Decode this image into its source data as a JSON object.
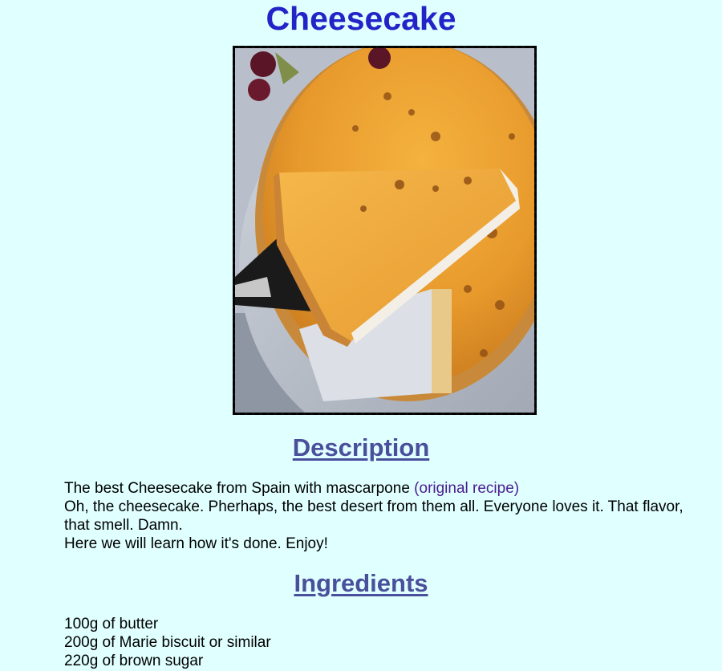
{
  "page": {
    "title": "Cheesecake",
    "image_description": "Slice of Basque cheesecake lifted on a spatula"
  },
  "description": {
    "heading": "Description",
    "intro_text": "The best Cheesecake from Spain with mascarpone ",
    "link_text": "(original recipe)",
    "paragraph_2": "Oh, the cheesecake. Pherhaps, the best desert from them all. Everyone loves it. That flavor, that smell. Damn.",
    "paragraph_3": "Here we will learn how it's done. Enjoy!"
  },
  "ingredients": {
    "heading": "Ingredients",
    "items": [
      "100g of butter",
      "200g of Marie biscuit or similar",
      "220g of brown sugar"
    ]
  },
  "colors": {
    "background": "#e0ffff",
    "title": "#2323c8",
    "section_heading": "#4a4f9b",
    "link": "#4b1c8f"
  }
}
